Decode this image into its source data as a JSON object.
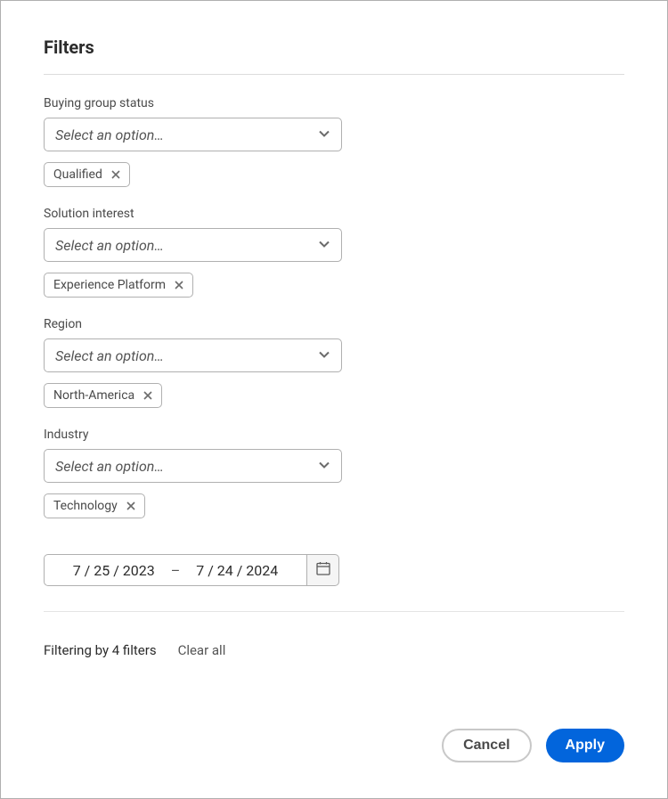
{
  "title": "Filters",
  "fields": {
    "buying_group_status": {
      "label": "Buying group status",
      "placeholder": "Select an option…",
      "chip": "Qualified"
    },
    "solution_interest": {
      "label": "Solution interest",
      "placeholder": "Select an option…",
      "chip": "Experience Platform"
    },
    "region": {
      "label": "Region",
      "placeholder": "Select an option…",
      "chip": "North-America"
    },
    "industry": {
      "label": "Industry",
      "placeholder": "Select an option…",
      "chip": "Technology"
    }
  },
  "date_range": {
    "start": "7 / 25 / 2023",
    "separator": "–",
    "end": "7 / 24 / 2024"
  },
  "summary": {
    "text": "Filtering by 4 filters",
    "clear": "Clear all"
  },
  "buttons": {
    "cancel": "Cancel",
    "apply": "Apply"
  }
}
